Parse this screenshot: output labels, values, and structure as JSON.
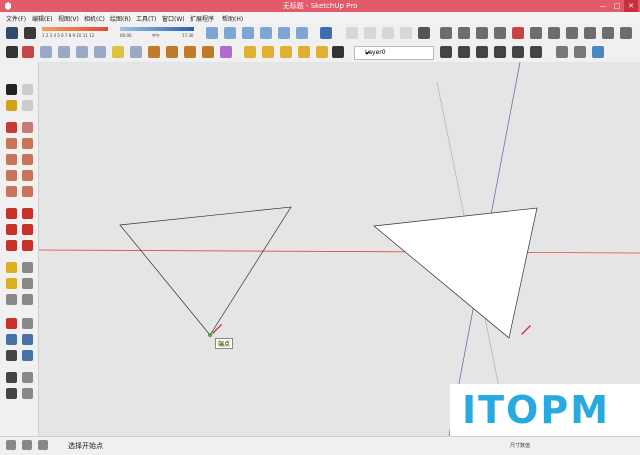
{
  "window": {
    "title": "无标题 - SketchUp Pro",
    "controls": {
      "minimize": "—",
      "maximize": "□",
      "close": "✕"
    }
  },
  "menu": [
    "文件(F)",
    "编辑(E)",
    "视图(V)",
    "相机(C)",
    "绘图(R)",
    "工具(T)",
    "窗口(W)",
    "扩展程序",
    "帮助(H)"
  ],
  "toolbar": {
    "ruler_numbers": "1 2 3 4 5 6 7 8 9 10 11 12",
    "time_start": "06:00",
    "time_noon": "中午",
    "time_end": "17:30",
    "layer_check": "✔",
    "layer_name": "Layer0"
  },
  "viewport": {
    "tooltip": "端点"
  },
  "status": {
    "message": "选择开始点",
    "measurement": "尺寸数值"
  },
  "watermark": "ITOPM",
  "colors": {
    "titlebar": "#e35b6a",
    "viewport_bg": "#e6e5e5",
    "red_axis": "#d84a4a",
    "blue_axis": "#6f6fa8",
    "green_axis": "#9fc79f",
    "watermark": "#28a9e0"
  }
}
